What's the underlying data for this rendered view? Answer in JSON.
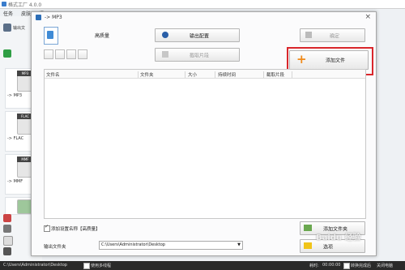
{
  "app": {
    "title": "格式工厂 4.0.0"
  },
  "menu": {
    "items": [
      "任务",
      "皮肤",
      "语"
    ]
  },
  "left_panel": {
    "category_label": "输出文",
    "tiles": [
      {
        "badge": "MP3",
        "label": "-> MP3"
      },
      {
        "badge": "FLAC",
        "label": "-> FLAC"
      },
      {
        "badge": "MMF",
        "label": "-> MMF"
      }
    ]
  },
  "dialog": {
    "title": "-> MP3",
    "close": "×",
    "quality_label": "高质量",
    "output_config_button": "输出配置",
    "confirm_button": "确定",
    "clip_button": "截取片段",
    "add_file_button": "添加文件",
    "file_list_headers": [
      "文件名",
      "文件夹",
      "大小",
      "持续时间",
      "截取片段"
    ],
    "add_settings_checkbox_label": "添加设置名称【高质量】",
    "add_folder_button": "添加文件夹",
    "output_folder_label": "输出文件夹",
    "output_folder_value": "C:\\Users\\Administrator\\Desktop",
    "bottom_right_button": "选项"
  },
  "statusbar": {
    "path": "C:\\Users\\Administrator\\Desktop",
    "multithread_label": "使用多线程",
    "elapsed_label": "耗时:",
    "elapsed_value": "00:00:00",
    "after_done_label": "转换完成后",
    "shutdown_label": "关闭电脑"
  },
  "watermark": "Baidu 经验",
  "colors": {
    "highlight": "#d9262b",
    "statusbar_bg": "#2a2a2a",
    "add_icon": "#f08a1a"
  }
}
